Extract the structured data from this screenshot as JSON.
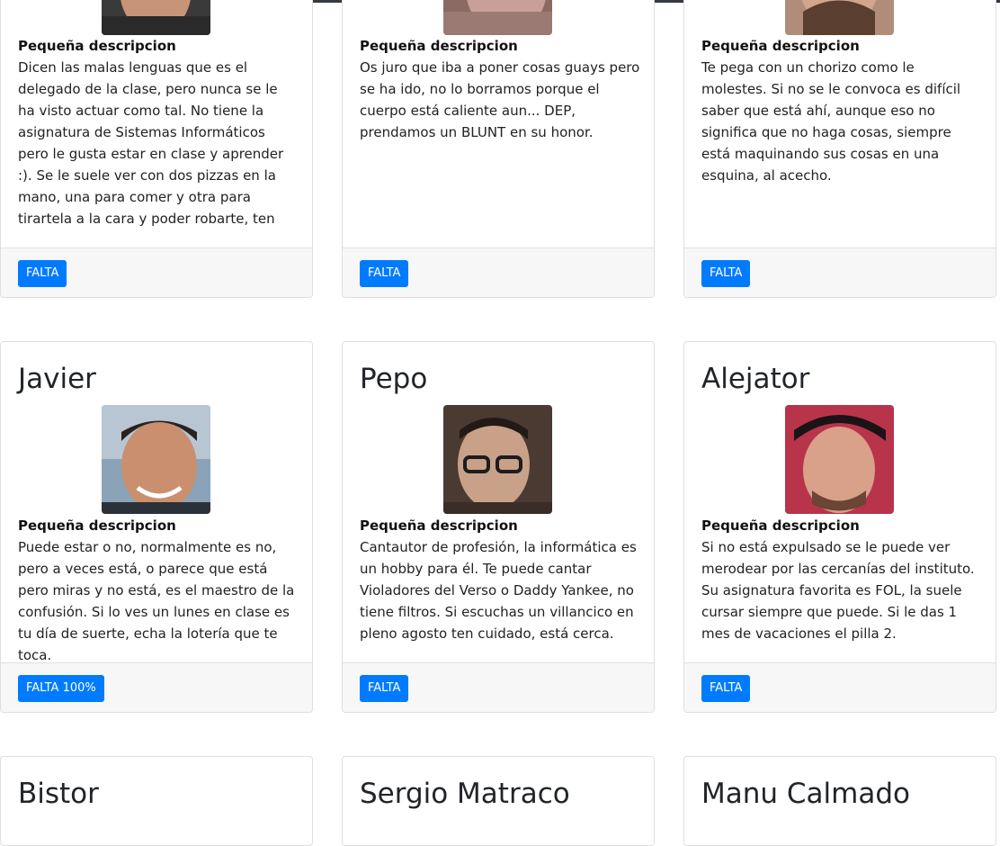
{
  "desc_label": "Pequeña descripcion",
  "accent_color": "#007bff",
  "cards_row1": [
    {
      "description": "Dicen las malas lenguas que es el delegado de la clase, pero nunca se le ha visto actuar como tal. No tiene la asignatura de Sistemas Informáticos pero le gusta estar en clase y aprender :). Se le suele ver con dos pizzas en la mano, una para comer y otra para tirartela a la cara y poder robarte, ten",
      "badge": "FALTA"
    },
    {
      "description": "Os juro que iba a poner cosas guays pero se ha ido, no lo borramos porque el cuerpo está caliente aun... DEP, prendamos un BLUNT en su honor.",
      "badge": "FALTA"
    },
    {
      "description": "Te pega con un chorizo como le molestes. Si no se le convoca es difícil saber que está ahí, aunque eso no significa que no haga cosas, siempre está maquinando sus cosas en una esquina, al acecho.",
      "badge": "FALTA"
    }
  ],
  "cards_row2": [
    {
      "name": "Javier",
      "description": "Puede estar o no, normalmente es no, pero a veces está, o parece que está pero miras y no está, es el maestro de la confusión. Si lo ves un lunes en clase es tu día de suerte, echa la lotería que te toca.",
      "badge": "FALTA 100%"
    },
    {
      "name": "Pepo",
      "description": "Cantautor de profesión, la informática es un hobby para él. Te puede cantar Violadores del Verso o Daddy Yankee, no tiene filtros. Si escuchas un villancico en pleno agosto ten cuidado, está cerca.",
      "badge": "FALTA"
    },
    {
      "name": "Alejator",
      "description": "Si no está expulsado se le puede ver merodear por las cercanías del instituto. Su asignatura favorita es FOL, la suele cursar siempre que puede. Si le das 1 mes de vacaciones el pilla 2.",
      "badge": "FALTA"
    }
  ],
  "cards_row3": [
    {
      "name": "Bistor"
    },
    {
      "name": "Sergio Matraco"
    },
    {
      "name": "Manu Calmado"
    }
  ]
}
